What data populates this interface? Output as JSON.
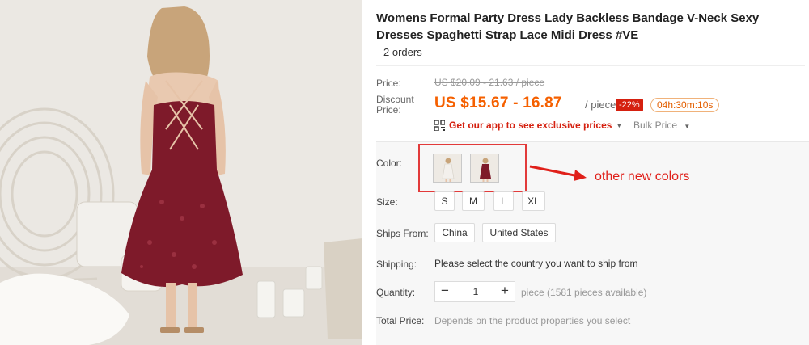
{
  "product": {
    "title": "Womens Formal Party Dress Lady Backless Bandage V-Neck Sexy Dresses Spaghetti Strap Lace Midi Dress #VE",
    "orders": "2 orders"
  },
  "price": {
    "label": "Price:",
    "original": "US $20.09 - 21.63 / piece",
    "discount_label": "Discount Price:",
    "discount": "US $15.67 - 16.87",
    "unit": "/ piece",
    "discount_badge": "-22%",
    "countdown": "04h:30m:10s"
  },
  "app_promo": {
    "text": "Get our app to see exclusive prices",
    "icon": "qr-code-icon"
  },
  "bulk_price": {
    "label": "Bulk Price"
  },
  "sku": {
    "color_label": "Color:",
    "annotation": "other new colors",
    "size_label": "Size:",
    "sizes": [
      "S",
      "M",
      "L",
      "XL"
    ],
    "ships_from_label": "Ships From:",
    "ships_from": [
      "China",
      "United States"
    ],
    "shipping_label": "Shipping:",
    "shipping_text": "Please select the country you want to ship from",
    "quantity_label": "Quantity:",
    "quantity": "1",
    "quantity_note": "piece (1581 pieces available)",
    "total_label": "Total Price:",
    "total_text": "Depends on the product properties you select"
  },
  "colors": {
    "accent": "#f56000",
    "sale_red": "#d5200f",
    "dress_burgundy": "#7e1a2a",
    "annotation_red": "#e0201a"
  }
}
